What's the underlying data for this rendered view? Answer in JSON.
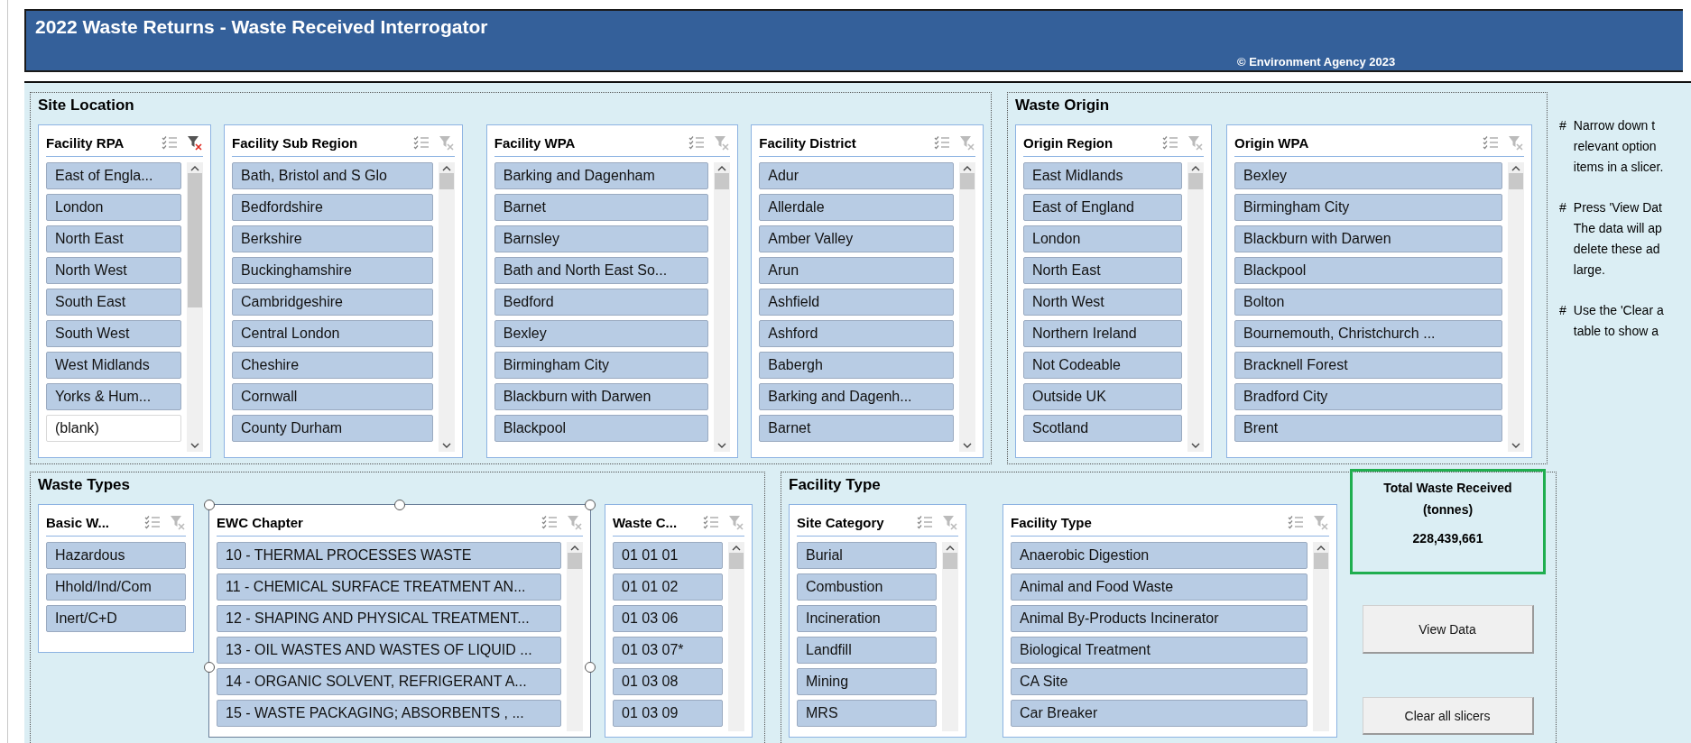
{
  "header": {
    "title": "2022 Waste Returns - Waste Received Interrogator",
    "copyright": "© Environment Agency 2023"
  },
  "groups": [
    {
      "title": "Site Location",
      "slicers": [
        {
          "title": "Facility RPA",
          "filtered": true,
          "selected": false,
          "items": [
            {
              "label": "East of Engla...",
              "selected": true
            },
            {
              "label": "London",
              "selected": true
            },
            {
              "label": "North East",
              "selected": true
            },
            {
              "label": "North West",
              "selected": true
            },
            {
              "label": "South East",
              "selected": true
            },
            {
              "label": "South West",
              "selected": true
            },
            {
              "label": "West Midlands",
              "selected": true
            },
            {
              "label": "Yorks & Hum...",
              "selected": true
            },
            {
              "label": "(blank)",
              "selected": false
            }
          ]
        },
        {
          "title": "Facility Sub Region",
          "filtered": false,
          "selected": false,
          "items": [
            {
              "label": "Bath, Bristol and S Glo",
              "selected": true
            },
            {
              "label": "Bedfordshire",
              "selected": true
            },
            {
              "label": "Berkshire",
              "selected": true
            },
            {
              "label": "Buckinghamshire",
              "selected": true
            },
            {
              "label": "Cambridgeshire",
              "selected": true
            },
            {
              "label": "Central London",
              "selected": true
            },
            {
              "label": "Cheshire",
              "selected": true
            },
            {
              "label": "Cornwall",
              "selected": true
            },
            {
              "label": "County Durham",
              "selected": true
            }
          ]
        },
        {
          "title": "Facility WPA",
          "filtered": false,
          "selected": false,
          "items": [
            {
              "label": "Barking and Dagenham",
              "selected": true
            },
            {
              "label": "Barnet",
              "selected": true
            },
            {
              "label": "Barnsley",
              "selected": true
            },
            {
              "label": "Bath and North East So...",
              "selected": true
            },
            {
              "label": "Bedford",
              "selected": true
            },
            {
              "label": "Bexley",
              "selected": true
            },
            {
              "label": "Birmingham City",
              "selected": true
            },
            {
              "label": "Blackburn with Darwen",
              "selected": true
            },
            {
              "label": "Blackpool",
              "selected": true
            }
          ]
        },
        {
          "title": "Facility District",
          "filtered": false,
          "selected": false,
          "items": [
            {
              "label": "Adur",
              "selected": true
            },
            {
              "label": "Allerdale",
              "selected": true
            },
            {
              "label": "Amber Valley",
              "selected": true
            },
            {
              "label": "Arun",
              "selected": true
            },
            {
              "label": "Ashfield",
              "selected": true
            },
            {
              "label": "Ashford",
              "selected": true
            },
            {
              "label": "Babergh",
              "selected": true
            },
            {
              "label": "Barking and Dagenh...",
              "selected": true
            },
            {
              "label": "Barnet",
              "selected": true
            }
          ]
        }
      ]
    },
    {
      "title": "Waste Origin",
      "slicers": [
        {
          "title": "Origin Region",
          "filtered": false,
          "selected": false,
          "items": [
            {
              "label": "East Midlands",
              "selected": true
            },
            {
              "label": "East of England",
              "selected": true
            },
            {
              "label": "London",
              "selected": true
            },
            {
              "label": "North East",
              "selected": true
            },
            {
              "label": "North West",
              "selected": true
            },
            {
              "label": "Northern Ireland",
              "selected": true
            },
            {
              "label": "Not Codeable",
              "selected": true
            },
            {
              "label": "Outside UK",
              "selected": true
            },
            {
              "label": "Scotland",
              "selected": true
            }
          ]
        },
        {
          "title": "Origin WPA",
          "filtered": false,
          "selected": false,
          "items": [
            {
              "label": "Bexley",
              "selected": true
            },
            {
              "label": "Birmingham City",
              "selected": true
            },
            {
              "label": "Blackburn with Darwen",
              "selected": true
            },
            {
              "label": "Blackpool",
              "selected": true
            },
            {
              "label": "Bolton",
              "selected": true
            },
            {
              "label": "Bournemouth, Christchurch ...",
              "selected": true
            },
            {
              "label": "Bracknell Forest",
              "selected": true
            },
            {
              "label": "Bradford City",
              "selected": true
            },
            {
              "label": "Brent",
              "selected": true
            }
          ]
        }
      ]
    },
    {
      "title": "Waste Types",
      "slicers": [
        {
          "title": "Basic W...",
          "filtered": false,
          "selected": false,
          "items": [
            {
              "label": "Hazardous",
              "selected": true
            },
            {
              "label": "Hhold/Ind/Com",
              "selected": true
            },
            {
              "label": "Inert/C+D",
              "selected": true
            }
          ]
        },
        {
          "title": "EWC Chapter",
          "filtered": false,
          "selected": true,
          "items": [
            {
              "label": "10 - THERMAL PROCESSES WASTE",
              "selected": true
            },
            {
              "label": "11 - CHEMICAL SURFACE TREATMENT AN...",
              "selected": true
            },
            {
              "label": "12 - SHAPING AND PHYSICAL TREATMENT...",
              "selected": true
            },
            {
              "label": "13 - OIL WASTES AND WASTES OF LIQUID ...",
              "selected": true
            },
            {
              "label": "14 - ORGANIC SOLVENT, REFRIGERANT A...",
              "selected": true
            },
            {
              "label": "15 - WASTE PACKAGING; ABSORBENTS , ...",
              "selected": true
            }
          ]
        },
        {
          "title": "Waste C...",
          "filtered": false,
          "selected": false,
          "items": [
            {
              "label": "01 01 01",
              "selected": true
            },
            {
              "label": "01 01 02",
              "selected": true
            },
            {
              "label": "01 03 06",
              "selected": true
            },
            {
              "label": "01 03 07*",
              "selected": true
            },
            {
              "label": "01 03 08",
              "selected": true
            },
            {
              "label": "01 03 09",
              "selected": true
            }
          ]
        }
      ]
    },
    {
      "title": "Facility Type",
      "slicers": [
        {
          "title": "Site Category",
          "filtered": false,
          "selected": false,
          "items": [
            {
              "label": "Burial",
              "selected": true
            },
            {
              "label": "Combustion",
              "selected": true
            },
            {
              "label": "Incineration",
              "selected": true
            },
            {
              "label": "Landfill",
              "selected": true
            },
            {
              "label": "Mining",
              "selected": true
            },
            {
              "label": "MRS",
              "selected": true
            }
          ]
        },
        {
          "title": "Facility Type",
          "filtered": false,
          "selected": false,
          "items": [
            {
              "label": "Anaerobic Digestion",
              "selected": true
            },
            {
              "label": "Animal and Food Waste",
              "selected": true
            },
            {
              "label": "Animal By-Products Incinerator",
              "selected": true
            },
            {
              "label": "Biological Treatment",
              "selected": true
            },
            {
              "label": "CA Site",
              "selected": true
            },
            {
              "label": "Car Breaker",
              "selected": true
            }
          ]
        }
      ]
    }
  ],
  "total": {
    "lines": [
      "Total Waste Received",
      "(tonnes)"
    ],
    "value": "228,439,661"
  },
  "buttons": [
    "View Data",
    "Clear all slicers"
  ],
  "notes": [
    {
      "marker": "#",
      "lines": [
        "Narrow down t",
        "relevant option",
        "items in a slicer."
      ]
    },
    {
      "marker": "#",
      "lines": [
        "Press 'View Dat",
        "The data will ap",
        "delete these ad",
        "large."
      ]
    },
    {
      "marker": "#",
      "lines": [
        "Use the 'Clear a",
        "table to show a"
      ]
    }
  ]
}
